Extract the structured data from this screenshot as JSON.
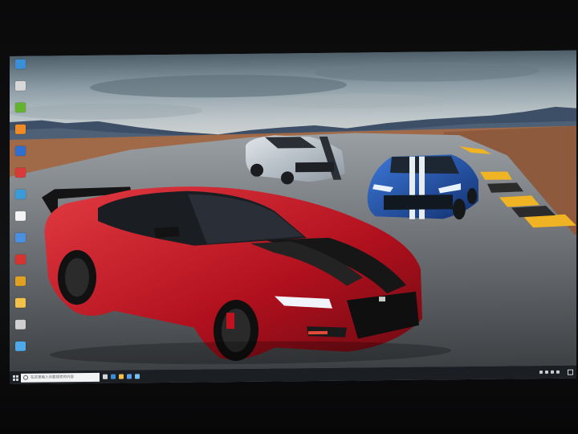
{
  "desktop": {
    "icons": [
      {
        "name": "edge-icon",
        "label": "",
        "color": "#3b8ed8"
      },
      {
        "name": "app-icon-1",
        "label": "",
        "color": "#d8d8d8"
      },
      {
        "name": "nvidia-icon",
        "label": "",
        "color": "#64b32e"
      },
      {
        "name": "app-icon-3",
        "label": "",
        "color": "#f08a24"
      },
      {
        "name": "app-icon-4",
        "label": "",
        "color": "#2f6fd1"
      },
      {
        "name": "app-icon-5",
        "label": "",
        "color": "#d83a3a"
      },
      {
        "name": "app-icon-6",
        "label": "",
        "color": "#3a9bd8"
      },
      {
        "name": "m-app-icon",
        "label": "",
        "color": "#f4f4f4"
      },
      {
        "name": "app-icon-8",
        "label": "",
        "color": "#4a8fe0"
      },
      {
        "name": "app-icon-9",
        "label": "",
        "color": "#d8342f"
      },
      {
        "name": "app-icon-10",
        "label": "",
        "color": "#e0a020"
      },
      {
        "name": "app-icon-11",
        "label": "",
        "color": "#f2c24a"
      },
      {
        "name": "app-icon-12",
        "label": "",
        "color": "#cfcfcf"
      },
      {
        "name": "app-icon-13",
        "label": "",
        "color": "#4fa8e8"
      }
    ]
  },
  "taskbar": {
    "search_placeholder": "在这里输入你要搜索的内容",
    "apps": [
      {
        "name": "task-view-icon",
        "color": "#cfd6dd"
      },
      {
        "name": "edge-taskbar-icon",
        "color": "#3b8ed8"
      },
      {
        "name": "file-explorer-icon",
        "color": "#f2c24a"
      },
      {
        "name": "store-icon",
        "color": "#5aa0e6"
      },
      {
        "name": "app-taskbar-icon",
        "color": "#7ac1ee"
      }
    ],
    "clock_time": "",
    "clock_date": ""
  },
  "colors": {
    "taskbar": "#1b1f24",
    "red_car": "#c0182a",
    "blue_car": "#1f4fa6",
    "silver_car": "#aeb7c0"
  }
}
